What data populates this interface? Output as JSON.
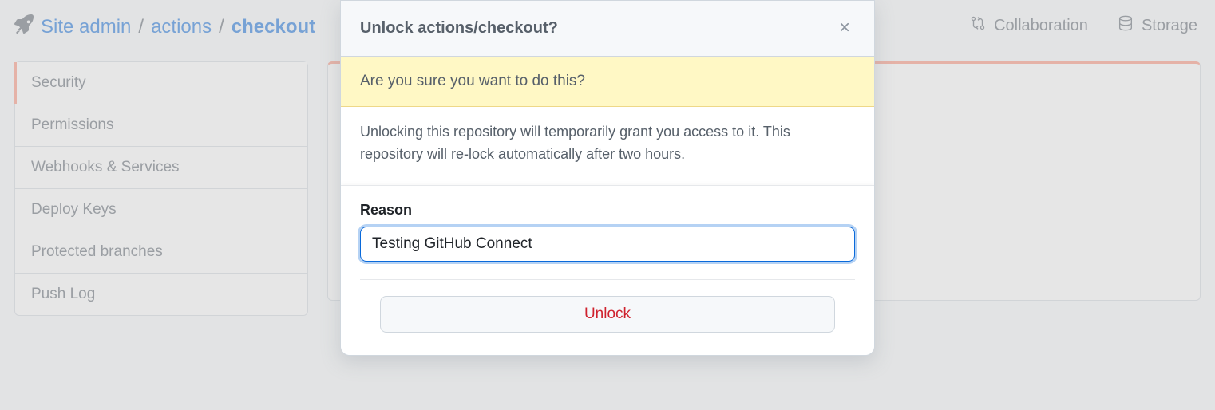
{
  "breadcrumb": {
    "root": "Site admin",
    "mid": "actions",
    "current": "checkout"
  },
  "top_tabs": {
    "collab": "Collaboration",
    "storage": "Storage"
  },
  "sidebar": {
    "items": [
      "Security",
      "Permissions",
      "Webhooks & Services",
      "Deploy Keys",
      "Protected branches",
      "Push Log"
    ]
  },
  "modal": {
    "title": "Unlock actions/checkout?",
    "warning": "Are you sure you want to do this?",
    "description": "Unlocking this repository will temporarily grant you access to it. This repository will re-lock automatically after two hours.",
    "reason_label": "Reason",
    "reason_value": "Testing GitHub Connect",
    "submit_label": "Unlock"
  }
}
